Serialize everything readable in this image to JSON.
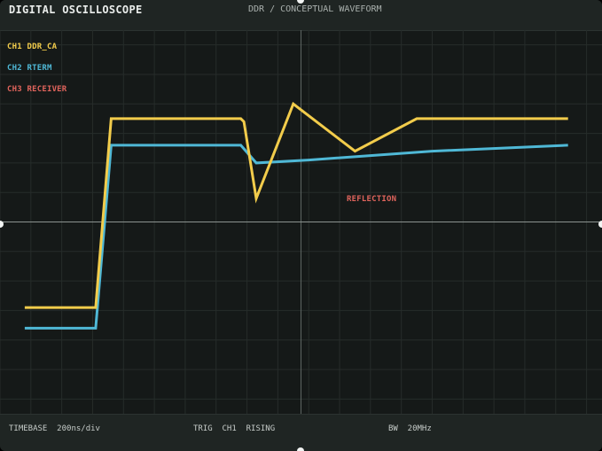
{
  "header": {
    "title": "DIGITAL OSCILLOSCOPE",
    "subtitle": "DDR / CONCEPTUAL WAVEFORM"
  },
  "channels": [
    {
      "label": "CH1 DDR_CA",
      "color": "#f2cc4b"
    },
    {
      "label": "CH2 RTERM",
      "color": "#4fb8d6"
    },
    {
      "label": "CH3 RECEIVER",
      "color": "#e0645c"
    }
  ],
  "annotation": {
    "text": "REFLECTION",
    "color": "#e0645c"
  },
  "chart_data": {
    "type": "line",
    "grid": true,
    "xlim": [
      0,
      19.5
    ],
    "ylim": [
      -6.5,
      6.5
    ],
    "series": [
      {
        "name": "CH1 DDR_CA",
        "color": "#f2cc4b",
        "x": [
          0.8,
          3.1,
          3.6,
          7.8,
          7.9,
          8.3,
          9.5,
          11.5,
          13.5,
          18.4
        ],
        "y": [
          -2.9,
          -2.9,
          3.5,
          3.5,
          3.4,
          0.8,
          4.0,
          2.4,
          3.5,
          3.5
        ]
      },
      {
        "name": "CH2 RTERM",
        "color": "#4fb8d6",
        "x": [
          0.8,
          3.1,
          3.6,
          7.8,
          8.3,
          10.0,
          14.0,
          18.4
        ],
        "y": [
          -3.6,
          -3.6,
          2.6,
          2.6,
          2.0,
          2.1,
          2.4,
          2.6
        ]
      }
    ]
  },
  "footer": {
    "timebase": "TIMEBASE  200ns/div",
    "trigger": "TRIG  CH1  RISING",
    "bandwidth": "BW  20MHz"
  }
}
